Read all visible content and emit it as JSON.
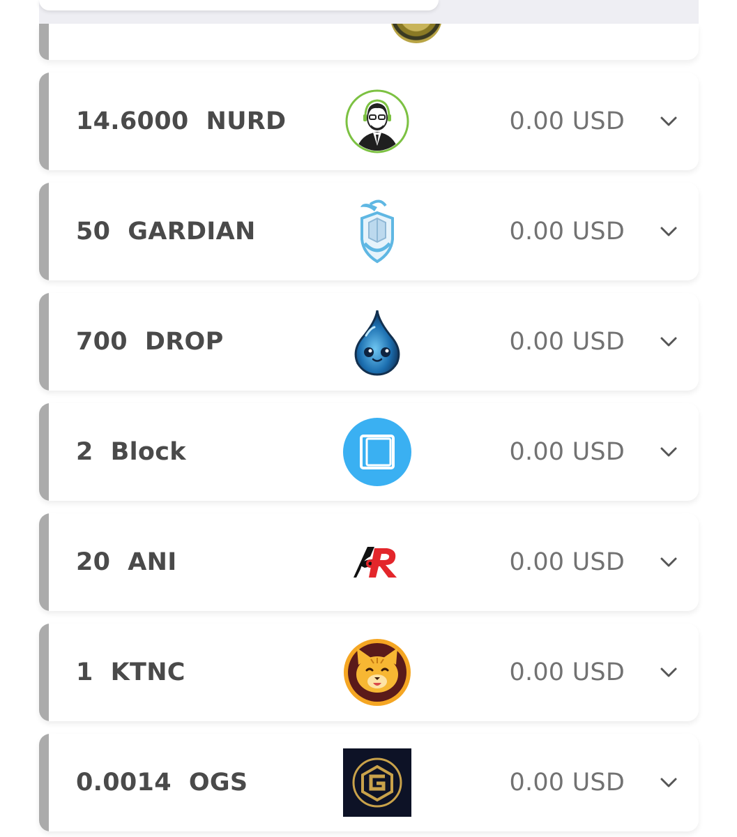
{
  "currency": "USD",
  "tokens": [
    {
      "amount": "14.6000  NURD",
      "value": "0.00 USD",
      "icon": "nurd-avatar-icon"
    },
    {
      "amount": "50  GARDIAN",
      "value": "0.00 USD",
      "icon": "gardian-knight-icon"
    },
    {
      "amount": "700  DROP",
      "value": "0.00 USD",
      "icon": "drop-water-icon"
    },
    {
      "amount": "2  Block",
      "value": "0.00 USD",
      "icon": "block-square-icon"
    },
    {
      "amount": "20  ANI",
      "value": "0.00 USD",
      "icon": "ani-logo-icon"
    },
    {
      "amount": "1  KTNC",
      "value": "0.00 USD",
      "icon": "ktnc-cat-icon"
    },
    {
      "amount": "0.0014  OGS",
      "value": "0.00 USD",
      "icon": "ogs-g-logo-icon"
    }
  ],
  "colors": {
    "accent_bar": "#ababab",
    "amount_text": "#4a4a4a",
    "value_text": "#727272",
    "block_blue": "#3ab0f2"
  }
}
